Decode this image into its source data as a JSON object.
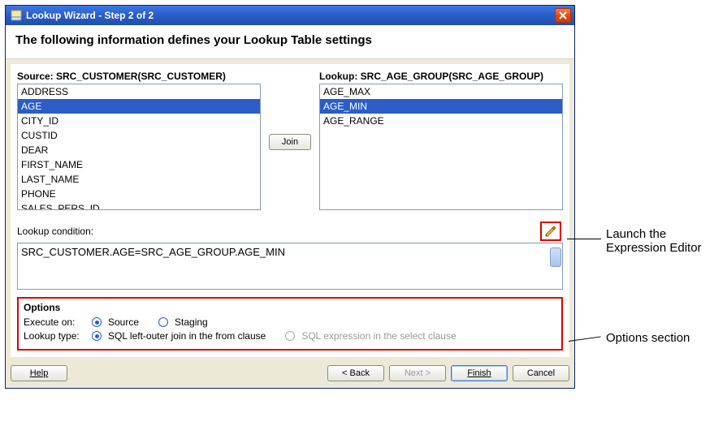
{
  "titlebar": {
    "text": "Lookup Wizard - Step 2 of 2"
  },
  "heading": "The following information defines your Lookup Table settings",
  "source": {
    "label": "Source: SRC_CUSTOMER(SRC_CUSTOMER)",
    "items": [
      "ADDRESS",
      "AGE",
      "CITY_ID",
      "CUSTID",
      "DEAR",
      "FIRST_NAME",
      "LAST_NAME",
      "PHONE",
      "SALES_PERS_ID"
    ],
    "selected": "AGE"
  },
  "lookup": {
    "label": "Lookup: SRC_AGE_GROUP(SRC_AGE_GROUP)",
    "items": [
      "AGE_MAX",
      "AGE_MIN",
      "AGE_RANGE"
    ],
    "selected": "AGE_MIN"
  },
  "join_btn": "Join",
  "condition": {
    "label": "Lookup condition:",
    "value": "SRC_CUSTOMER.AGE=SRC_AGE_GROUP.AGE_MIN"
  },
  "options": {
    "title": "Options",
    "execute_label": "Execute on:",
    "execute_source": "Source",
    "execute_staging": "Staging",
    "lookup_type_label": "Lookup type:",
    "lt_leftouter": "SQL left-outer join in the from clause",
    "lt_select": "SQL expression in the select clause"
  },
  "buttons": {
    "help": "Help",
    "back": "< Back",
    "next": "Next >",
    "finish": "Finish",
    "cancel": "Cancel"
  },
  "annotations": {
    "launch_editor_l1": "Launch the",
    "launch_editor_l2": "Expression Editor",
    "options_section": "Options section"
  }
}
